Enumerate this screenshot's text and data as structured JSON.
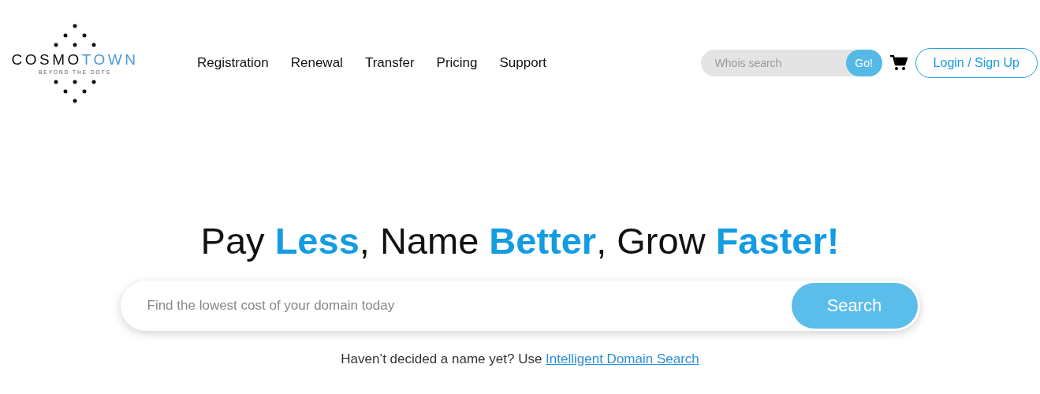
{
  "logo": {
    "word_dark": "COSMO",
    "word_light": "TOWN",
    "tagline": "BEYOND THE DOTS"
  },
  "nav": [
    "Registration",
    "Renewal",
    "Transfer",
    "Pricing",
    "Support"
  ],
  "whois": {
    "placeholder": "Whois search",
    "button": "Go!"
  },
  "login": "Login / Sign Up",
  "headline": "Pay **Less**, Name **Better**, Grow **Faster!**",
  "domain_search": {
    "placeholder": "Find the lowest cost of your domain today",
    "button": "Search"
  },
  "hint": {
    "text": "Haven’t decided a name yet? Use",
    "link": "Intelligent Domain Search"
  }
}
